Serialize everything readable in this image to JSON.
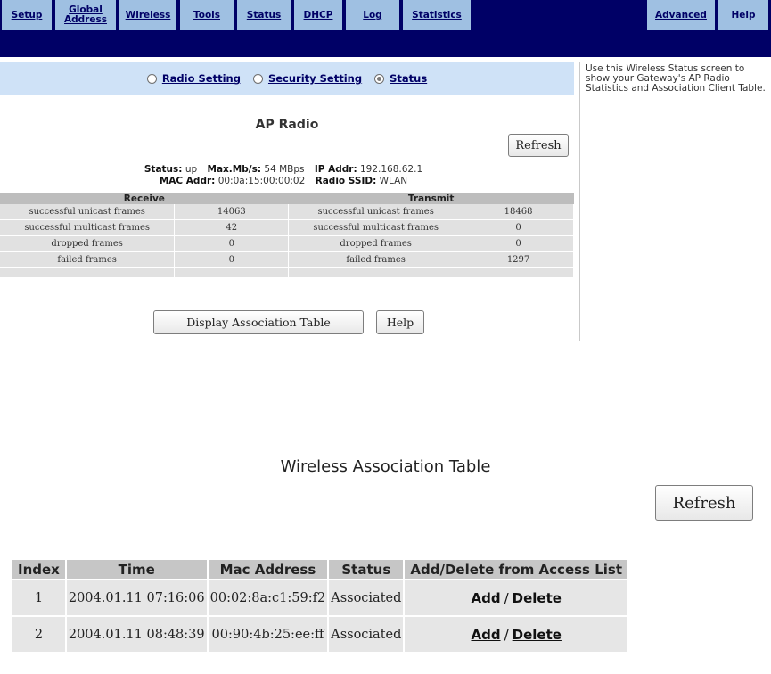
{
  "nav": {
    "items": [
      "Setup",
      "Global Address",
      "Wireless",
      "Tools",
      "Status",
      "DHCP",
      "Log",
      "Statistics"
    ],
    "global_line1": "Global",
    "global_line2": "Address",
    "advanced": "Advanced",
    "help": "Help"
  },
  "radio_tabs": [
    {
      "label": "Radio Setting",
      "selected": false
    },
    {
      "label": "Security Setting",
      "selected": false
    },
    {
      "label": "Status",
      "selected": true
    }
  ],
  "ap": {
    "title": "AP Radio",
    "refresh": "Refresh",
    "status_label": "Status:",
    "status": "up",
    "maxmbs_label": "Max.Mb/s:",
    "maxmbs": "54 MBps",
    "ip_label": "IP Addr:",
    "ip": "192.168.62.1",
    "mac_label": "MAC Addr:",
    "mac": "00:0a:15:00:00:02",
    "ssid_label": "Radio SSID:",
    "ssid": "WLAN"
  },
  "stats": {
    "receive_header": "Receive",
    "transmit_header": "Transmit",
    "rows": [
      {
        "rx_label": "successful unicast frames",
        "rx": "14063",
        "tx_label": "successful unicast frames",
        "tx": "18468"
      },
      {
        "rx_label": "successful multicast frames",
        "rx": "42",
        "tx_label": "successful multicast frames",
        "tx": "0"
      },
      {
        "rx_label": "dropped frames",
        "rx": "0",
        "tx_label": "dropped frames",
        "tx": "0"
      },
      {
        "rx_label": "failed frames",
        "rx": "0",
        "tx_label": "failed frames",
        "tx": "1297"
      }
    ]
  },
  "buttons": {
    "display_assoc": "Display Association Table",
    "help": "Help"
  },
  "sidebar": {
    "text": "Use this Wireless Status screen to show your Gateway's AP Radio Statistics and Association Client Table."
  },
  "assoc": {
    "title": "Wireless Association Table",
    "refresh": "Refresh",
    "headers": [
      "Index",
      "Time",
      "Mac Address",
      "Status",
      "Add/Delete from Access List"
    ],
    "rows": [
      {
        "index": "1",
        "time": "2004.01.11 07:16:06",
        "mac": "00:02:8a:c1:59:f2",
        "status": "Associated",
        "add": "Add",
        "sep": "/",
        "delete": "Delete"
      },
      {
        "index": "2",
        "time": "2004.01.11 08:48:39",
        "mac": "00:90:4b:25:ee:ff",
        "status": "Associated",
        "add": "Add",
        "sep": "/",
        "delete": "Delete"
      }
    ]
  },
  "colors": {
    "nav_background": "#000066",
    "nav_button": "#9fc0e2",
    "radio_bar": "#cfe2f7",
    "table_header": "#bdbdbd",
    "table_cell": "#e1e1e1"
  }
}
